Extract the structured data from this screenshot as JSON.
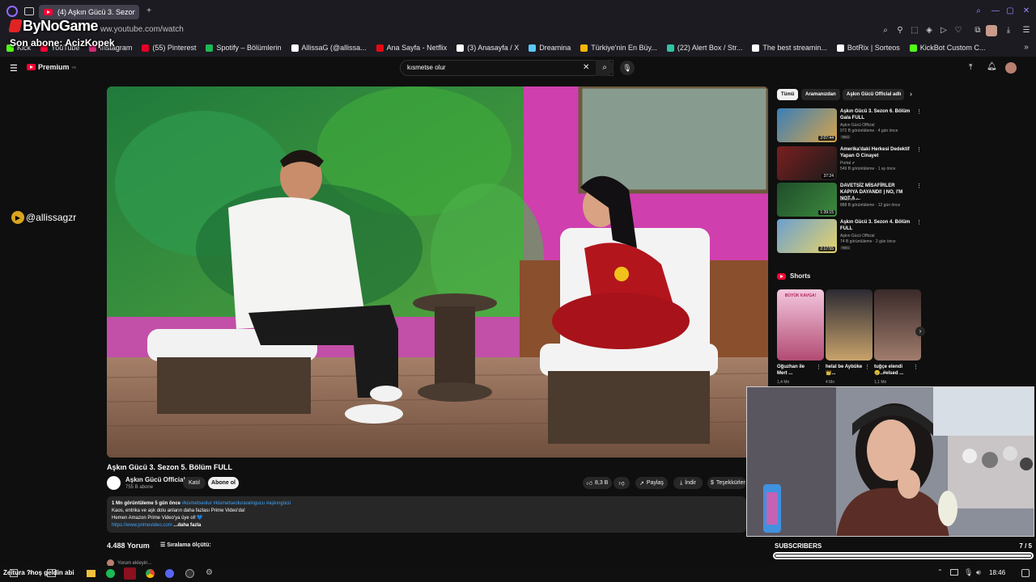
{
  "browser": {
    "tab_title": "(4) Aşkın Gücü 3. Sezon 5",
    "url": "ww.youtube.com/watch",
    "bookmarks": [
      {
        "label": "Kick",
        "color": "#53fc18"
      },
      {
        "label": "YouTube",
        "color": "#ff0033"
      },
      {
        "label": "Instagram",
        "color": "#d62976"
      },
      {
        "label": "(55) Pinterest",
        "color": "#e60023"
      },
      {
        "label": "Spotify – Bölümlerin",
        "color": "#1db954"
      },
      {
        "label": "AllissaG (@allissa...",
        "color": "#ffffff"
      },
      {
        "label": "Ana Sayfa - Netflix",
        "color": "#e50914"
      },
      {
        "label": "(3) Anasayfa / X",
        "color": "#ffffff"
      },
      {
        "label": "Dreamina",
        "color": "#5ac8fa"
      },
      {
        "label": "Türkiye'nin En Büy...",
        "color": "#f5b700"
      },
      {
        "label": "(22) Alert Box / Str...",
        "color": "#31c3a2"
      },
      {
        "label": "The best streamin...",
        "color": "#ffffff"
      },
      {
        "label": "BotRix | Sorteos",
        "color": "#ffffff"
      },
      {
        "label": "KickBot Custom C...",
        "color": "#53fc18"
      }
    ]
  },
  "overlay": {
    "brand": "ByNoGame",
    "last_sub": "Son abone: AcizKopek",
    "handle": "@allissagzr"
  },
  "youtube": {
    "logo_text": "Premium",
    "logo_sup": "TR",
    "search_value": "kısmetse olur",
    "video_title": "Aşkın Gücü 3. Sezon 5. Bölüm FULL",
    "channel_name": "Aşkın Gücü Official",
    "channel_subs": "755 B abone",
    "join_label": "Katıl",
    "subscribe_label": "Abone ol",
    "likes": "8,3 B",
    "share_label": "Paylaş",
    "download_label": "İndir",
    "thanks_label": "Teşekkürler",
    "desc_stats": "1 Mn görüntüleme  5 gün önce",
    "desc_tags": "#kismetseolur #kismetseolurasкingucu #aşkıngücü",
    "desc_line1": "Kaos, entrika ve aşk dolu anların daha fazlası Prime Video'da!",
    "desc_line2": "Hemen Amazon Prime Video'ya üye ol! 💙",
    "desc_link": "https://www.primevideo.com",
    "desc_more": "...daha fazla",
    "comments_count": "4.488 Yorum",
    "sort_label": "Sıralama ölçütü:",
    "comment_placeholder": "Yorum ekleyin..."
  },
  "sidebar": {
    "chips": [
      "Tümü",
      "Aramanızdan",
      "Aşkın Gücü Official adlı"
    ],
    "recommendations": [
      {
        "title": "Aşkın Gücü 3. Sezon 6. Bölüm Gala FULL",
        "channel": "Aşkın Gücü Official",
        "meta": "972 B görüntüleme · 4 gün önce",
        "badge": "Yeni",
        "duration": "2:07:44"
      },
      {
        "title": "Amerika'daki Herkesi Dedektif Yapan O Cinayet",
        "channel": "Portal ✔",
        "meta": "549 B görüntüleme · 1 ay önce",
        "badge": "",
        "duration": "37:24"
      },
      {
        "title": "DAVETSİZ MİSAFİRLER KAPIYA DAYANDI! | NO, I'M NOT A ...",
        "channel": "Elraenn ✔",
        "meta": "888 B görüntüleme · 12 gün önce",
        "badge": "",
        "duration": "1:39:15"
      },
      {
        "title": "Aşkın Gücü 3. Sezon 4. Bölüm FULL",
        "channel": "Aşkın Gücü Official",
        "meta": "74 B görüntüleme · 2 gün önce",
        "badge": "Yeni",
        "duration": "2:17:55"
      }
    ],
    "shorts_label": "Shorts",
    "shorts": [
      {
        "title": "Oğuzhan ile Mert ...",
        "views": "1,4 Mn"
      },
      {
        "title": "helal be Aybüke 👑...",
        "views": "4 Mn"
      },
      {
        "title": "tuğçe elendi 😢..#elsed ...",
        "views": "1,1 Mn"
      }
    ],
    "shorts_thumb_text": "BÜYÜK KAVGA!"
  },
  "subs_goal": {
    "label": "SUBSCRIBERS",
    "count": "7 / 5",
    "progress": 1.0
  },
  "taskbar": {
    "ticker": "Zeitura ?hoş geldin abi",
    "clock": "18:46"
  }
}
